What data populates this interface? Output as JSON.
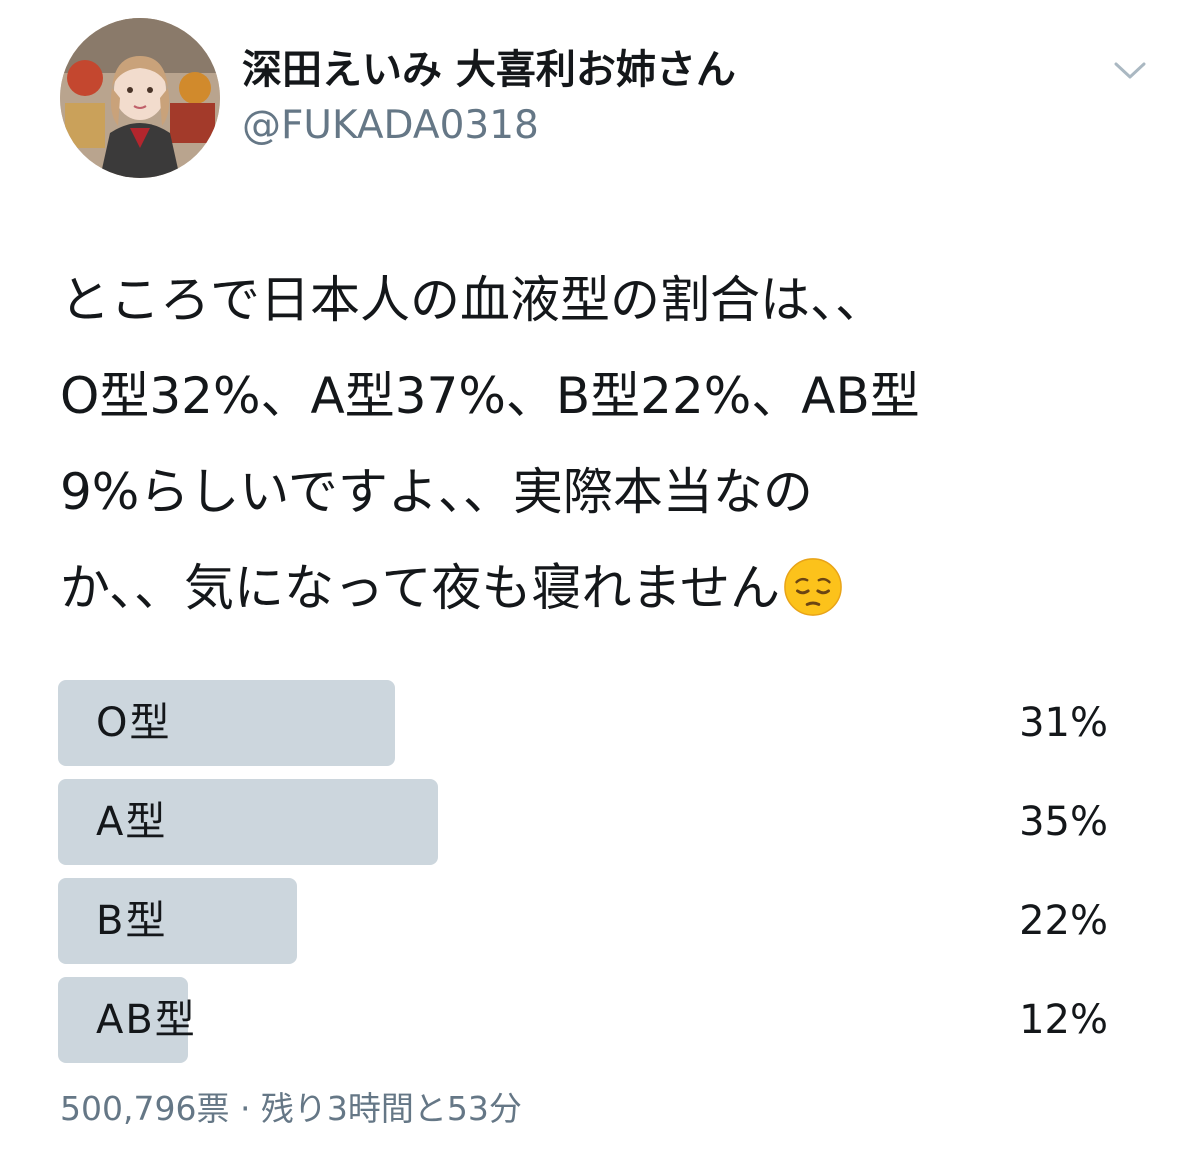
{
  "user": {
    "display_name": "深田えいみ 大喜利お姉さん",
    "handle": "@FUKADA0318",
    "avatar_icon": "profile-avatar",
    "caret_icon": "chevron-down-icon"
  },
  "tweet": {
    "lines": [
      "ところで日本人の血液型の割合は、、",
      "O型32%、A型37%、B型22%、AB型",
      "9%らしいですよ、、実際本当なの",
      "か、、気になって夜も寝れません"
    ],
    "emoji": "pensive-face"
  },
  "poll": {
    "options": [
      {
        "label": "O型",
        "percent_text": "31%",
        "bar_fraction": 0.31
      },
      {
        "label": "A型",
        "percent_text": "35%",
        "bar_fraction": 0.35
      },
      {
        "label": "B型",
        "percent_text": "22%",
        "bar_fraction": 0.22
      },
      {
        "label": "AB型",
        "percent_text": "12%",
        "bar_fraction": 0.12
      }
    ],
    "footer": "500,796票 · 残り3時間と53分",
    "colors": {
      "bar": "#ccd6dd",
      "text": "#14171a",
      "secondary": "#657786"
    }
  }
}
